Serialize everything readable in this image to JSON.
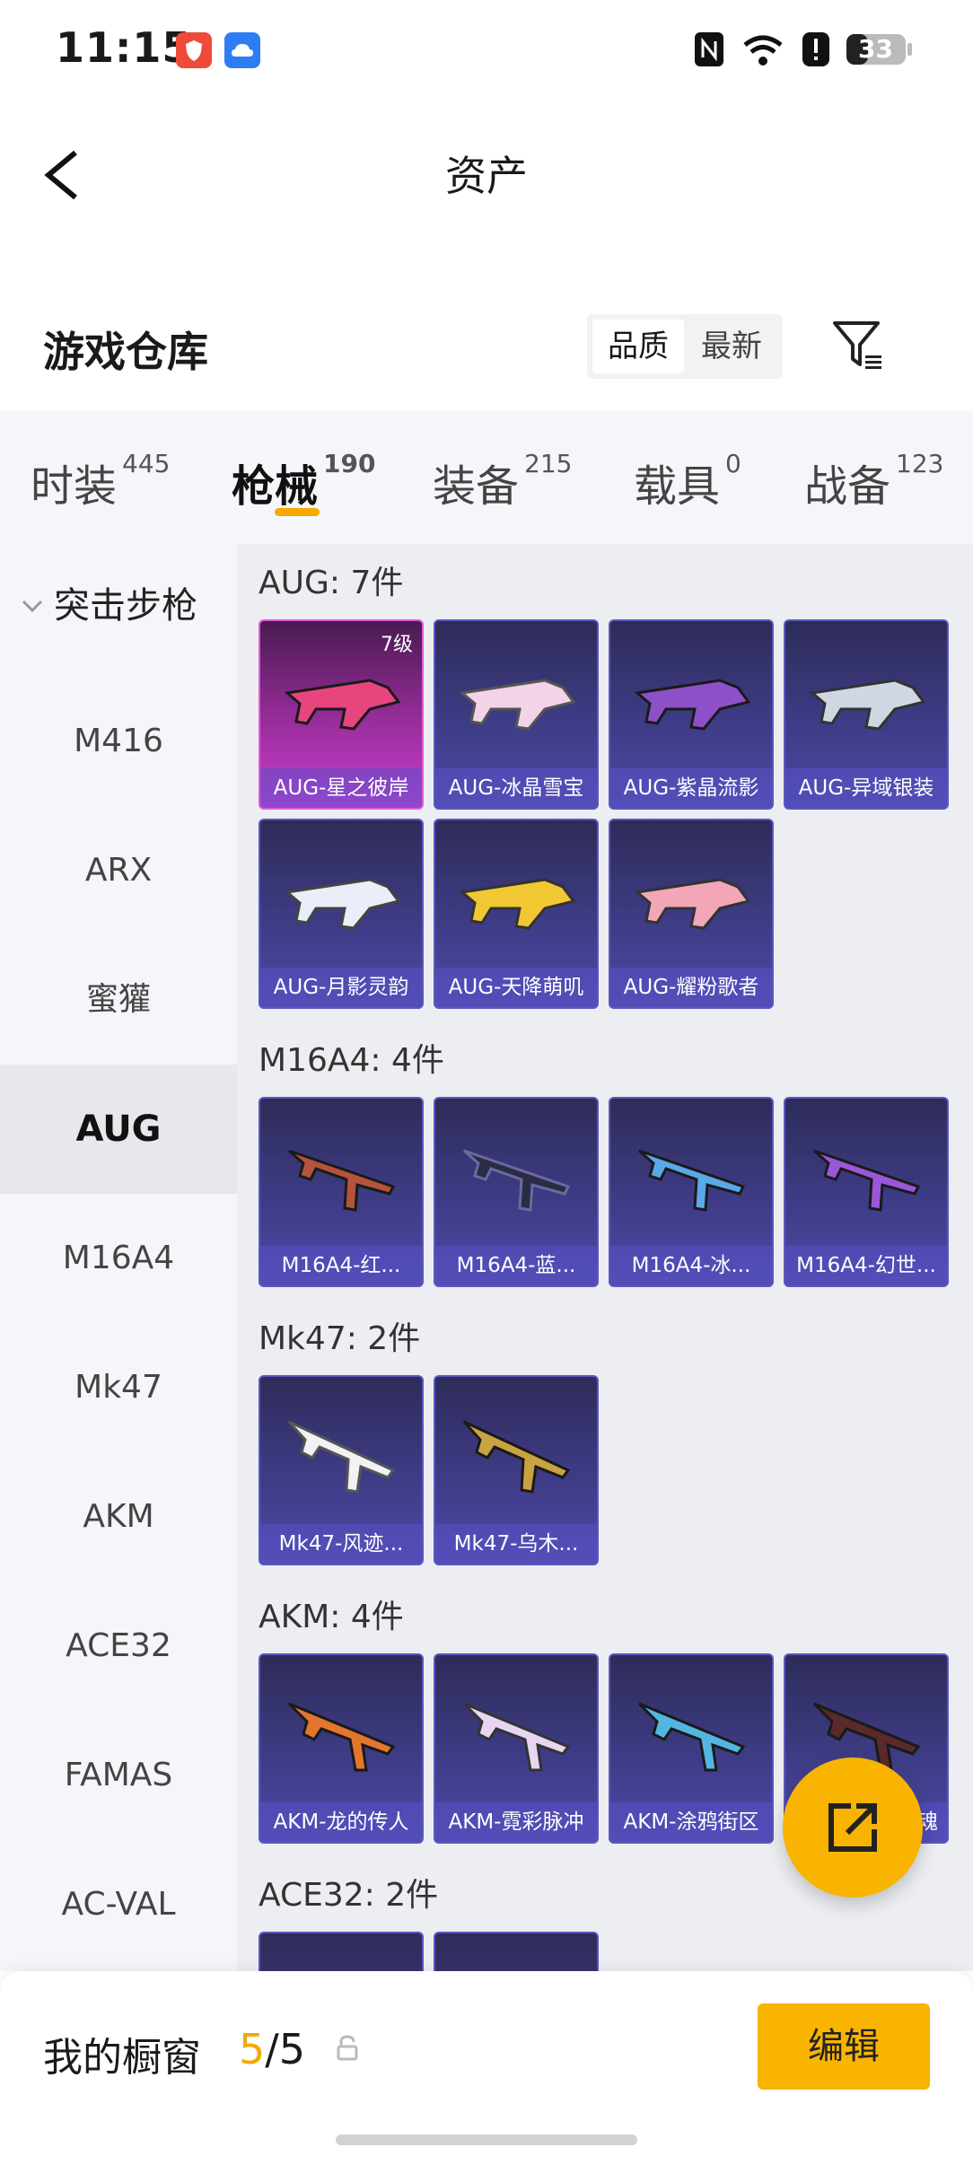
{
  "status_bar": {
    "time": "11:15",
    "battery": "33"
  },
  "header": {
    "title": "资产"
  },
  "section": {
    "title": "游戏仓库",
    "sort_quality": "品质",
    "sort_latest": "最新"
  },
  "tabs": [
    {
      "label": "时装",
      "count": "445"
    },
    {
      "label": "枪械",
      "count": "190"
    },
    {
      "label": "装备",
      "count": "215"
    },
    {
      "label": "载具",
      "count": "0"
    },
    {
      "label": "战备",
      "count": "123"
    }
  ],
  "sidebar": {
    "category": "突击步枪",
    "items": [
      "M416",
      "ARX",
      "蜜獾",
      "AUG",
      "M16A4",
      "Mk47",
      "AKM",
      "ACE32",
      "FAMAS",
      "AC-VAL"
    ]
  },
  "groups": [
    {
      "title": "AUG: 7件",
      "items": [
        {
          "name": "AUG-星之彼岸",
          "level": "7级",
          "color": "#e8457f"
        },
        {
          "name": "AUG-冰晶雪宝",
          "color": "#f3d3e8"
        },
        {
          "name": "AUG-紫晶流影",
          "color": "#8e50c8"
        },
        {
          "name": "AUG-异域银装",
          "color": "#cfd7e2"
        },
        {
          "name": "AUG-月影灵韵",
          "color": "#e9eef8"
        },
        {
          "name": "AUG-天降萌叽",
          "color": "#f1c832"
        },
        {
          "name": "AUG-耀粉歌者",
          "color": "#f2a6b8"
        }
      ]
    },
    {
      "title": "M16A4: 4件",
      "items": [
        {
          "name": "M16A4-红...",
          "color": "#b5543c"
        },
        {
          "name": "M16A4-蓝...",
          "color": "#2b2b45"
        },
        {
          "name": "M16A4-冰...",
          "color": "#5aa8e8"
        },
        {
          "name": "M16A4-幻世...",
          "color": "#9a58d8"
        }
      ]
    },
    {
      "title": "Mk47: 2件",
      "items": [
        {
          "name": "Mk47-风迹...",
          "color": "#f2f2f5"
        },
        {
          "name": "Mk47-乌木...",
          "color": "#c9a241"
        }
      ]
    },
    {
      "title": "AKM: 4件",
      "items": [
        {
          "name": "AKM-龙的传人",
          "color": "#e3762e"
        },
        {
          "name": "AKM-霓彩脉冲",
          "color": "#e8d6f0"
        },
        {
          "name": "AKM-涂鸦街区",
          "color": "#52b6e0"
        },
        {
          "name": "AKM-...魂",
          "label_visible": "魂",
          "color": "#5a2a2a"
        }
      ]
    },
    {
      "title": "ACE32: 2件",
      "items": []
    }
  ],
  "bottom_bar": {
    "label": "我的橱窗",
    "count_current": "5",
    "count_total": "/5",
    "edit": "编辑"
  },
  "colors": {
    "accent": "#f8b400",
    "card": "#3e3c86",
    "selected_card": "#cc3ed0"
  }
}
